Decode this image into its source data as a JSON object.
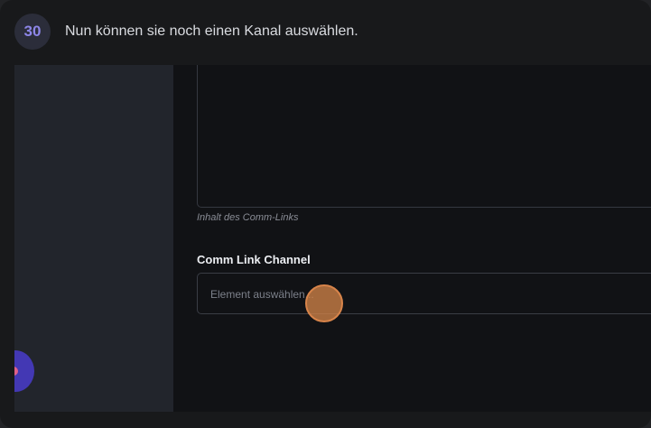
{
  "step": {
    "number": "30",
    "instruction": "Nun können sie noch einen Kanal auswählen."
  },
  "form": {
    "content_hint": "Inhalt des Comm-Links",
    "channel_label": "Comm Link Channel",
    "channel_placeholder": "Element auswählen..."
  },
  "colors": {
    "badge_text": "#8d86e8",
    "click_marker": "#d8844a",
    "fab": "#4338b4"
  }
}
